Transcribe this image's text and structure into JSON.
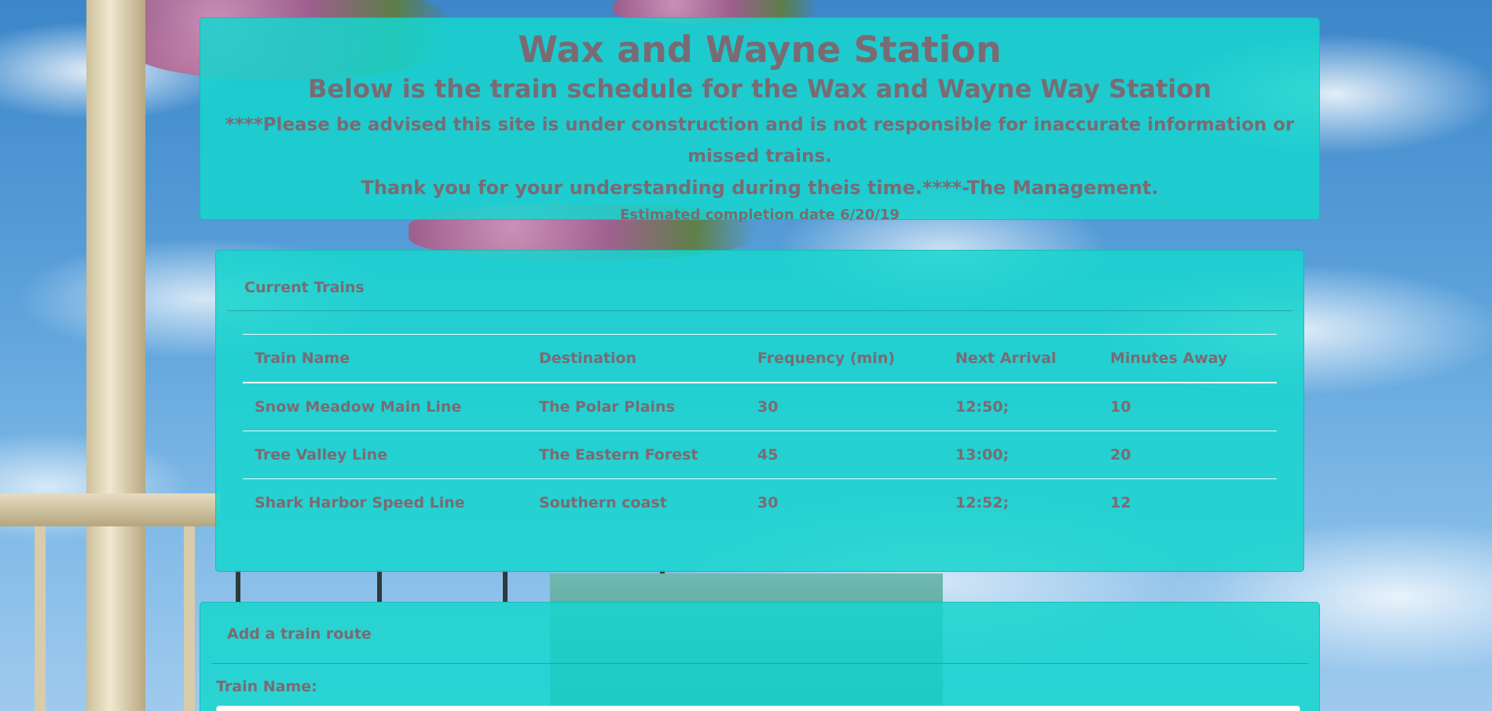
{
  "header": {
    "title": "Wax and Wayne Station",
    "subtitle": "Below is the train schedule for the Wax and Wayne Way Station",
    "notice_line1": "****Please be advised this site is under construction and is not responsible for inaccurate information or missed trains.",
    "notice_line2": "Thank you for your understanding during theis time.****-The Management.",
    "completion_date": "Estimated completion date 6/20/19"
  },
  "current_trains": {
    "title": "Current Trains",
    "columns": [
      "Train Name",
      "Destination",
      "Frequency (min)",
      "Next Arrival",
      "Minutes Away"
    ],
    "rows": [
      [
        "Snow Meadow Main Line",
        "The Polar Plains",
        "30",
        "12:50;",
        "10"
      ],
      [
        "Tree Valley Line",
        "The Eastern Forest",
        "45",
        "13:00;",
        "20"
      ],
      [
        "Shark Harbor Speed Line",
        "Southern coast",
        "30",
        "12:52;",
        "12"
      ]
    ]
  },
  "add_route": {
    "title": "Add a train route",
    "train_name_label": "Train Name:",
    "train_name_value": ""
  },
  "colors": {
    "panel": "#17d5ce",
    "text": "#7a6b73",
    "sky": "#5aa0da"
  }
}
